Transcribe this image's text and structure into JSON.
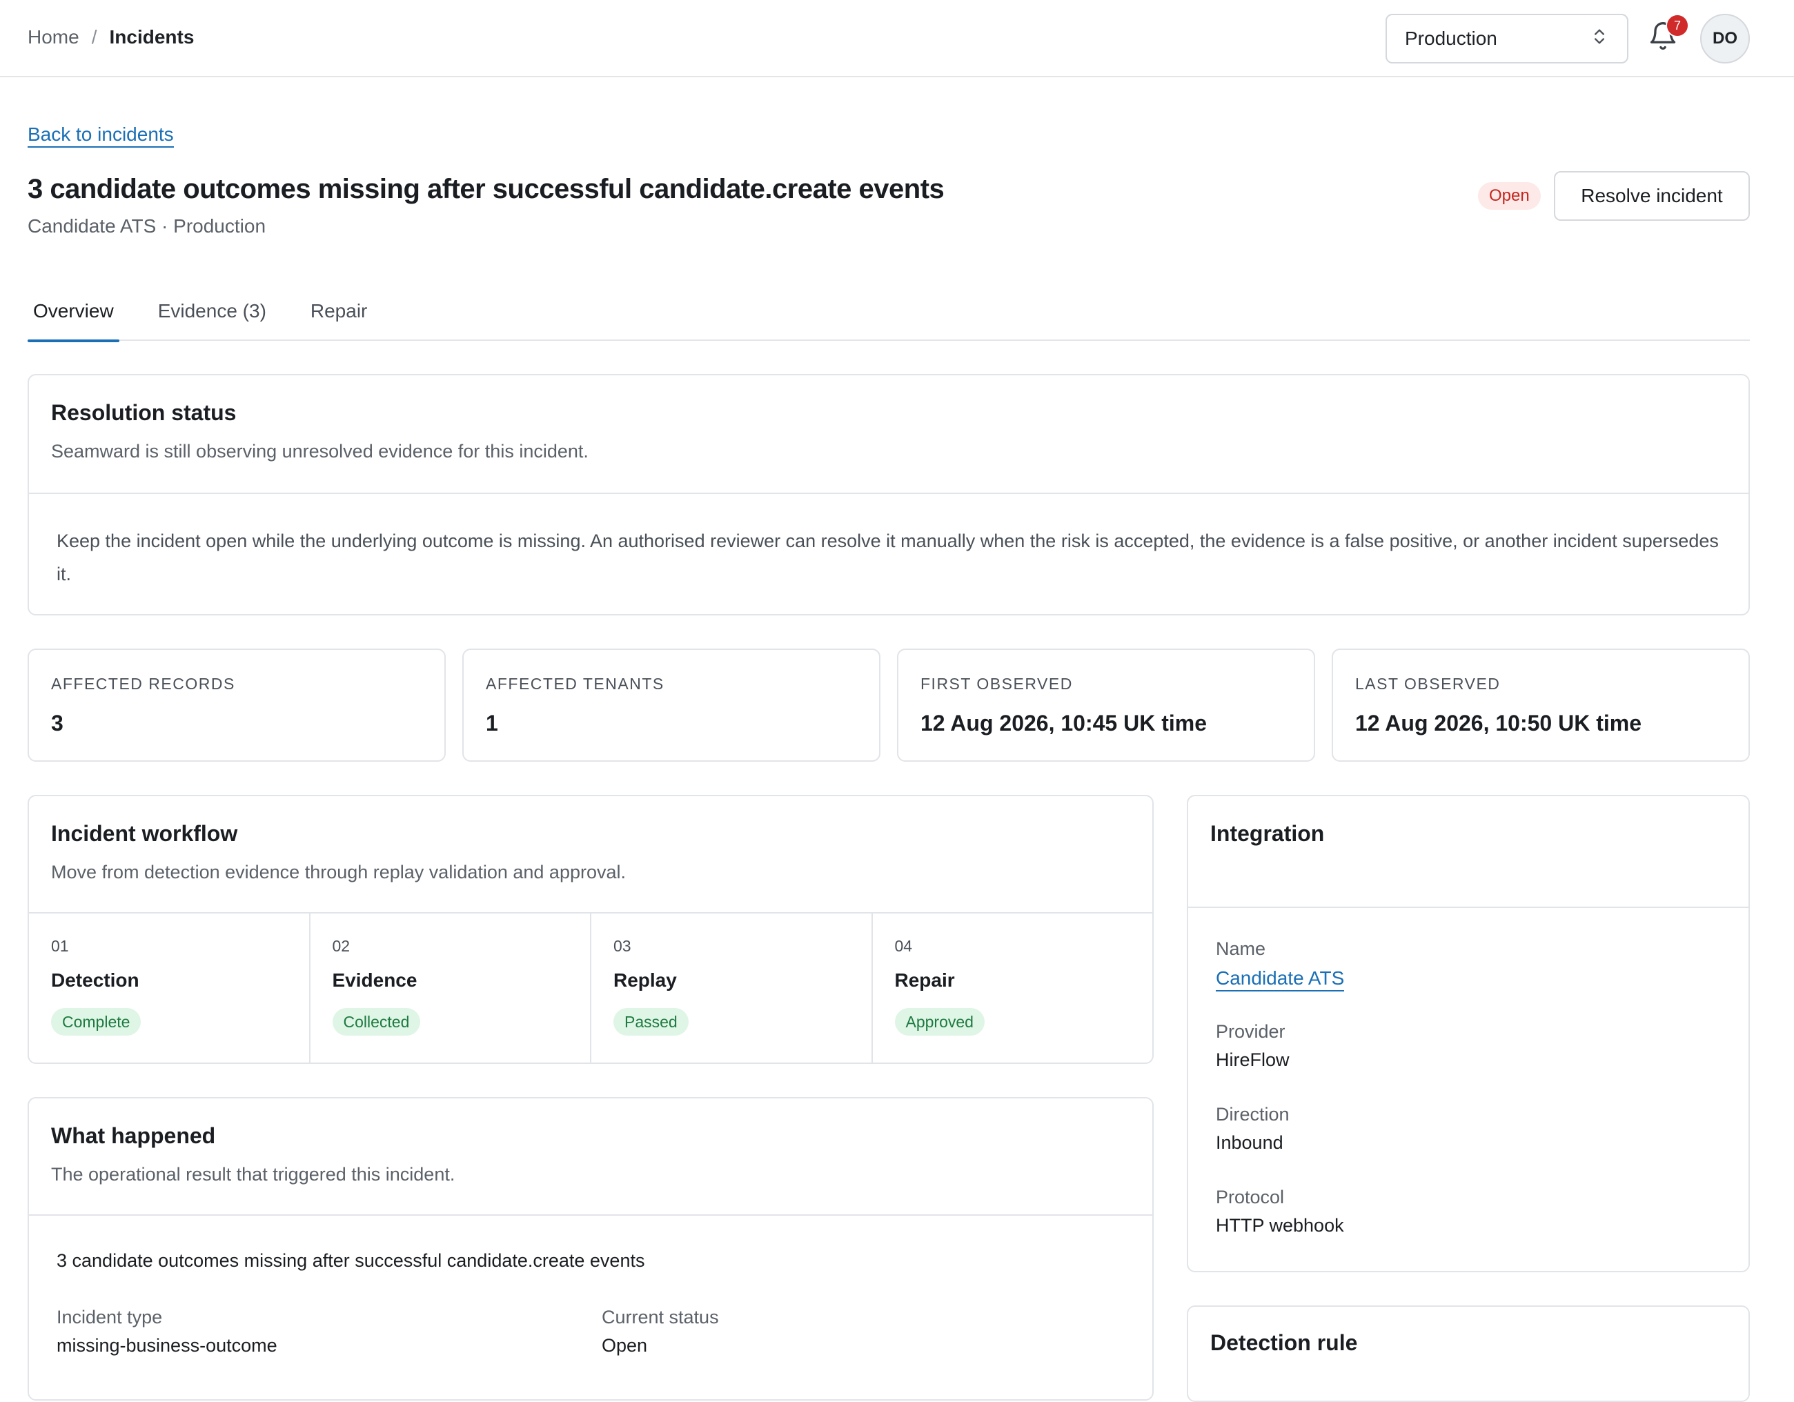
{
  "breadcrumb": {
    "home": "Home",
    "separator": "/",
    "current": "Incidents"
  },
  "environment": {
    "selected": "Production"
  },
  "notifications": {
    "count": "7"
  },
  "user": {
    "initials": "DO"
  },
  "header": {
    "back_link": "Back to incidents",
    "title": "3 candidate outcomes missing after successful candidate.create events",
    "subtitle": "Candidate ATS · Production",
    "status": "Open",
    "resolve_button": "Resolve incident"
  },
  "tabs": [
    {
      "label": "Overview",
      "active": true
    },
    {
      "label": "Evidence (3)",
      "active": false
    },
    {
      "label": "Repair",
      "active": false
    }
  ],
  "resolution": {
    "title": "Resolution status",
    "description": "Seamward is still observing unresolved evidence for this incident.",
    "body": "Keep the incident open while the underlying outcome is missing. An authorised reviewer can resolve it manually when the risk is accepted, the evidence is a false positive, or another incident supersedes it."
  },
  "metrics": [
    {
      "label": "AFFECTED RECORDS",
      "value": "3"
    },
    {
      "label": "AFFECTED TENANTS",
      "value": "1"
    },
    {
      "label": "FIRST OBSERVED",
      "value": "12 Aug 2026, 10:45 UK time"
    },
    {
      "label": "LAST OBSERVED",
      "value": "12 Aug 2026, 10:50 UK time"
    }
  ],
  "workflow": {
    "title": "Incident workflow",
    "description": "Move from detection evidence through replay validation and approval.",
    "steps": [
      {
        "num": "01",
        "name": "Detection",
        "status": "Complete"
      },
      {
        "num": "02",
        "name": "Evidence",
        "status": "Collected"
      },
      {
        "num": "03",
        "name": "Replay",
        "status": "Passed"
      },
      {
        "num": "04",
        "name": "Repair",
        "status": "Approved"
      }
    ],
    "status_color": "#1d7a3f"
  },
  "what_happened": {
    "title": "What happened",
    "description": "The operational result that triggered this incident.",
    "summary": "3 candidate outcomes missing after successful candidate.create events",
    "incident_type_label": "Incident type",
    "incident_type_value": "missing-business-outcome",
    "current_status_label": "Current status",
    "current_status_value": "Open"
  },
  "integration": {
    "title": "Integration",
    "name_label": "Name",
    "name_value": "Candidate ATS",
    "provider_label": "Provider",
    "provider_value": "HireFlow",
    "direction_label": "Direction",
    "direction_value": "Inbound",
    "protocol_label": "Protocol",
    "protocol_value": "HTTP webhook"
  },
  "detection_rule": {
    "title": "Detection rule"
  },
  "colors": {
    "accent": "#1a6fb5",
    "danger": "#c4271f",
    "success_bg": "#dff5e6"
  }
}
